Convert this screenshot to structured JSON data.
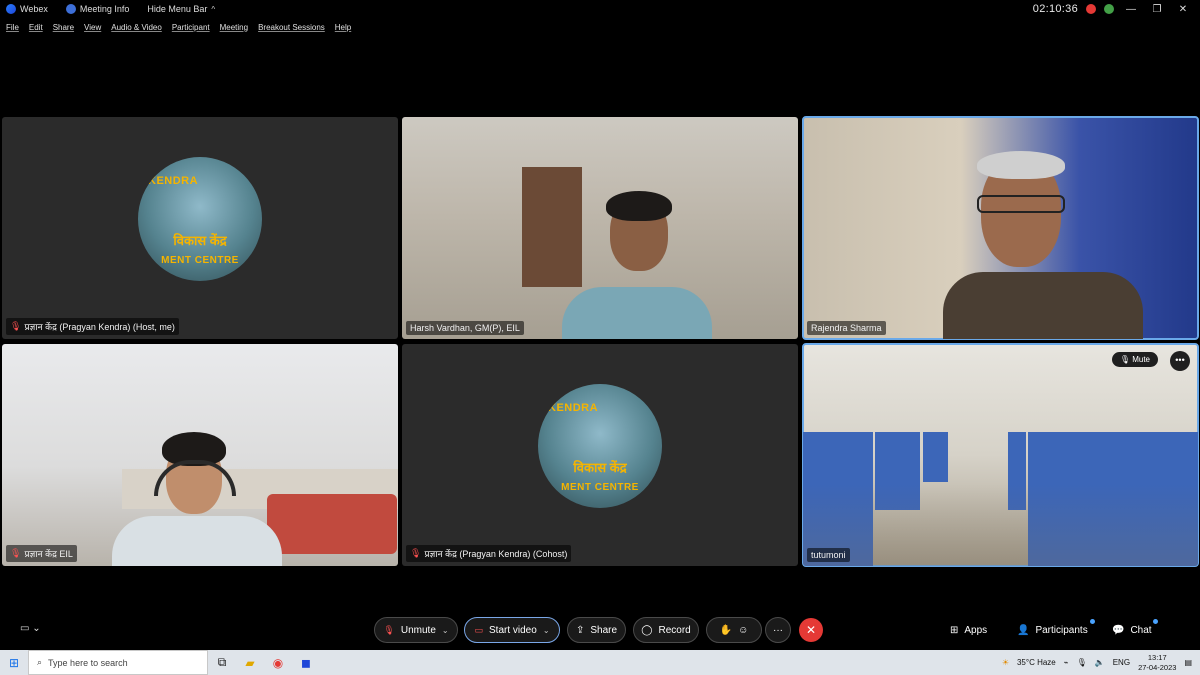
{
  "window": {
    "app_name": "Webex",
    "meeting_info": "Meeting Info",
    "hide_menu_bar": "Hide Menu Bar",
    "timer": "02:10:36"
  },
  "menu": [
    "File",
    "Edit",
    "Share",
    "View",
    "Audio & Video",
    "Participant",
    "Meeting",
    "Breakout Sessions",
    "Help"
  ],
  "tiles": {
    "t1": {
      "name": "प्रज्ञान केंद्र (Pragyan Kendra) (Host, me)"
    },
    "t2": {
      "name": "Harsh Vardhan, GM(P), EIL"
    },
    "t3": {
      "name": "Rajendra Sharma"
    },
    "t4": {
      "name": "प्रज्ञान केंद्र EIL"
    },
    "t5": {
      "name": "प्रज्ञान केंद्र (Pragyan Kendra) (Cohost)"
    },
    "t6": {
      "name": "tutumoni",
      "mute": "Mute"
    }
  },
  "avatar": {
    "top_text": "KENDRA",
    "mid_text": "विकास केंद्र",
    "bot_text": "MENT  CENTRE"
  },
  "controls": {
    "unmute": "Unmute",
    "start_video": "Start video",
    "share": "Share",
    "record": "Record",
    "apps": "Apps",
    "participants": "Participants",
    "chat": "Chat"
  },
  "taskbar": {
    "search_placeholder": "Type here to search",
    "weather": "35°C  Haze",
    "lang": "ENG",
    "time": "13:17",
    "date": "27-04-2023"
  },
  "colors": {
    "accent": "#6aa9e9",
    "end_call": "#e53935",
    "mic_off": "#ff5252"
  }
}
